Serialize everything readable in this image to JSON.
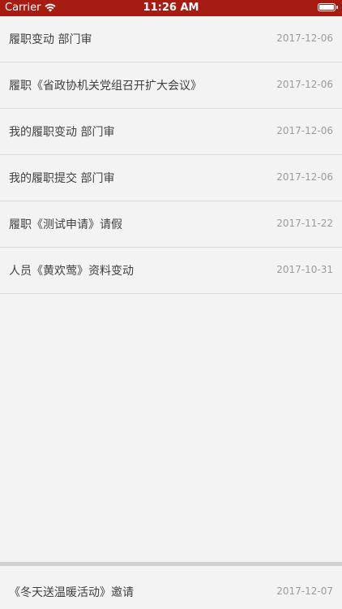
{
  "status_bar": {
    "carrier": "Carrier",
    "time": "11:26 AM",
    "wifi_icon": "wifi-icon",
    "battery_icon": "battery-icon"
  },
  "colors": {
    "status_bar_bg": "#a61c12",
    "background": "#f3f3f3",
    "title_text": "#3f3f3f",
    "date_text": "#9b9b9b",
    "separator": "#d9d9d9"
  },
  "list": {
    "items": [
      {
        "title": "履职变动 部门审",
        "date": "2017-12-06"
      },
      {
        "title": "履职《省政协机关党组召开扩大会议》",
        "date": "2017-12-06"
      },
      {
        "title": "我的履职变动 部门审",
        "date": "2017-12-06"
      },
      {
        "title": "我的履职提交 部门审",
        "date": "2017-12-06"
      },
      {
        "title": "履职《测试申请》请假",
        "date": "2017-11-22"
      },
      {
        "title": "人员《黄欢莺》资料变动",
        "date": "2017-10-31"
      }
    ]
  },
  "bottom": {
    "title": "《冬天送温暖活动》邀请",
    "date": "2017-12-07"
  }
}
